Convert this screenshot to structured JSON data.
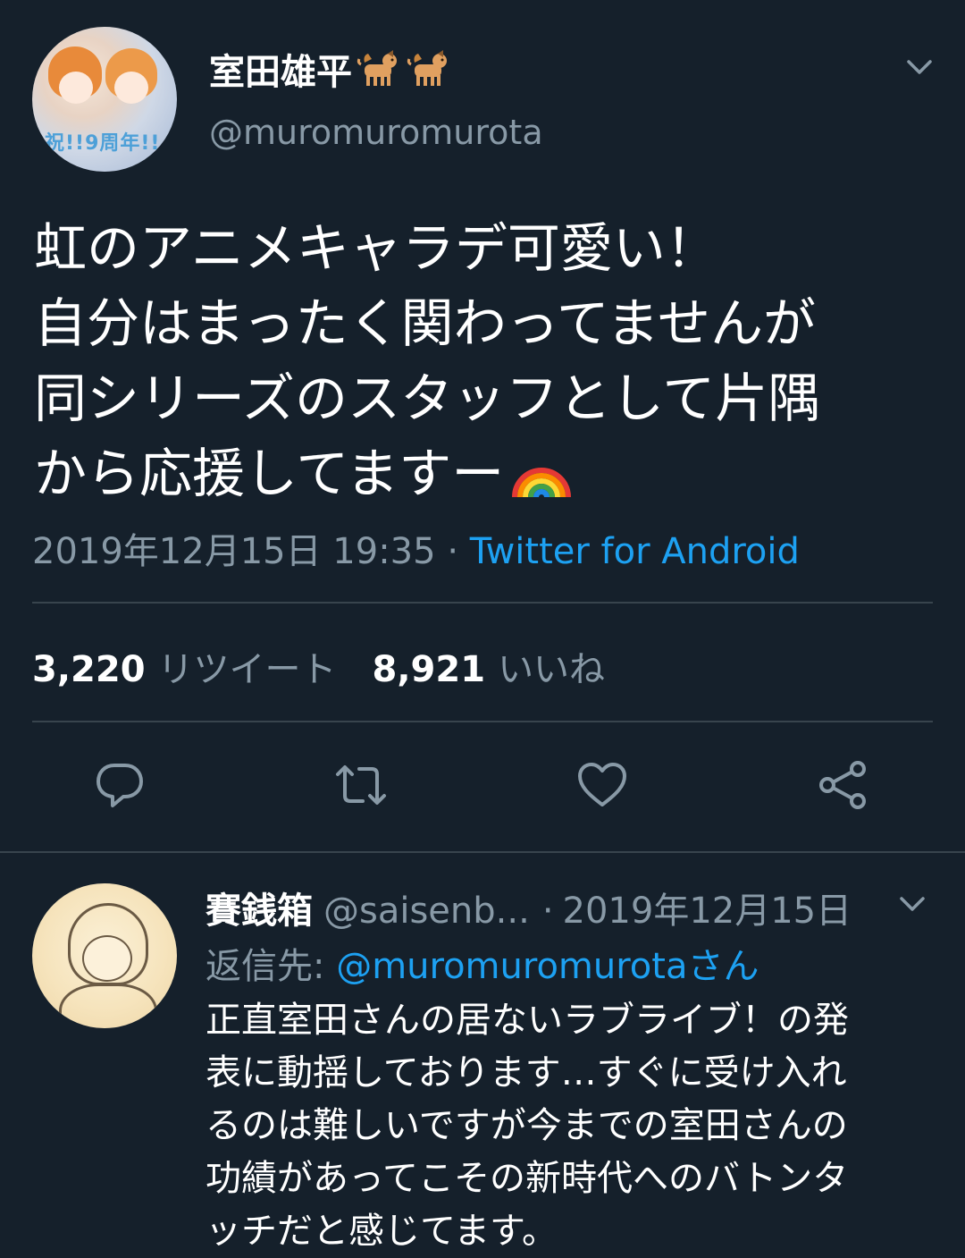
{
  "tweet": {
    "display_name": "室田雄平",
    "name_emoji": [
      "dog-emoji",
      "dog-emoji"
    ],
    "handle": "@muromuromurota",
    "avatar_banner_text": "祝!!9周年!!",
    "text_lines": [
      "虹のアニメキャラデ可愛い！",
      "自分はまったく関わってませんが",
      "同シリーズのスタッフとして片隅",
      "から応援してますー"
    ],
    "text_end_emoji": "rainbow-emoji",
    "timestamp": "2019年12月15日 19:35",
    "separator": "·",
    "source": "Twitter for Android",
    "retweet_count": "3,220",
    "retweet_label": "リツイート",
    "like_count": "8,921",
    "like_label": "いいね",
    "actions": [
      "reply-icon",
      "retweet-icon",
      "like-icon",
      "share-icon"
    ]
  },
  "reply": {
    "display_name": "賽銭箱",
    "handle": "@saisenb...",
    "separator": "·",
    "date": "2019年12月15日",
    "reply_to_label": "返信先: ",
    "reply_to_mention": "@muromuromurotaさん",
    "text_lines": [
      "正直室田さんの居ないラブライブ！の発",
      "表に動揺しております…すぐに受け入れ",
      "るのは難しいですが今までの室田さんの",
      "功績があってこその新時代へのバトンタ",
      "ッチだと感じてます。"
    ]
  },
  "colors": {
    "background": "#15202b",
    "text_primary": "#ffffff",
    "text_secondary": "#8899a6",
    "accent": "#1da1f2",
    "divider": "#38444d"
  }
}
